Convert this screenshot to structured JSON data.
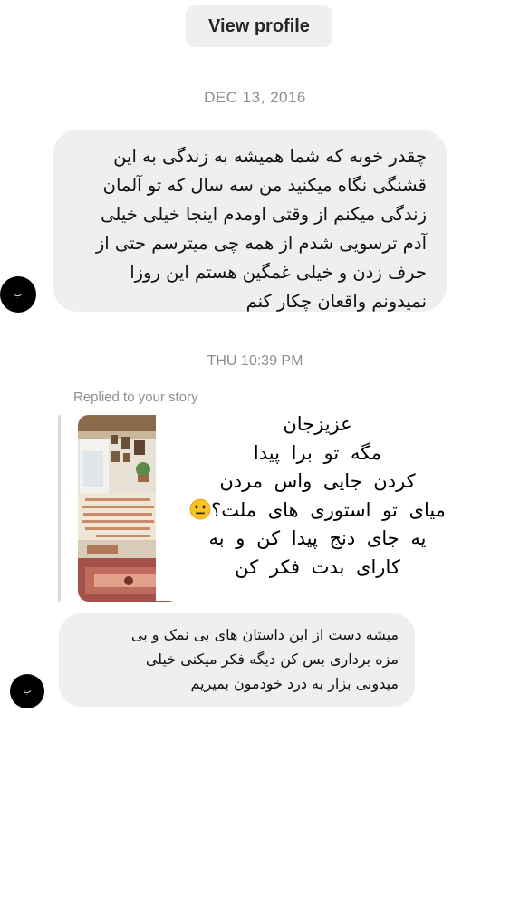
{
  "header": {
    "view_profile_label": "View profile"
  },
  "timestamps": {
    "first": "DEC 13, 2016",
    "second": "THU 10:39 PM"
  },
  "messages": [
    {
      "lines": [
        "چقدر خوبه که شما همیشه به زندگی به این",
        "قشنگی نگاه میکنید من سه سال که تو آلمان",
        "زندگی میکنم از وقتی اومدم اینجا خیلی خیلی",
        "آدم ترسویی شدم از همه چی میترسم حتی از",
        "حرف زدن و خیلی غمگین هستم این روزا",
        "نمیدونم واقعان چکار کنم"
      ]
    },
    {
      "lines": [
        "میشه دست از این داستان های بی نمک و بی",
        "مزه برداری بس کن دیگه فکر میکنی خیلی",
        "میدونی بزار به درد خودمون بمیریم"
      ]
    }
  ],
  "story_reply": {
    "label": "Replied to your story",
    "text_lines": [
      "عزیزجان",
      "مگه تو برا پیدا",
      "کردن جایی واس مردن",
      "میای تو استوری های ملت؟",
      "یه جای دنج پیدا کن و به",
      "کارای بدت فکر کن"
    ],
    "emoji": "neutral-face-emoji"
  },
  "avatar_glyph": "ب",
  "colors": {
    "bubble_bg": "#efefef",
    "timestamp": "#8e8e8e",
    "button_bg": "#efefef"
  }
}
